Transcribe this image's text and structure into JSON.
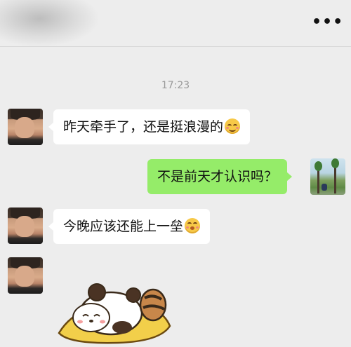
{
  "header": {
    "more_label": "•••",
    "more_icon": "more-dots-icon"
  },
  "chat": {
    "timestamp": "17:23",
    "messages": [
      {
        "side": "left",
        "text": "昨天牵手了，还是挺浪漫的",
        "emoji": "smile-emoji"
      },
      {
        "side": "right",
        "text": "不是前天才认识吗？"
      },
      {
        "side": "left",
        "text": "今晚应该还能上一垒",
        "emoji": "shy-emoji"
      },
      {
        "side": "left",
        "type": "sticker",
        "sticker": "sleeping-panda-sticker"
      }
    ]
  },
  "colors": {
    "background": "#ededed",
    "bubble_left": "#ffffff",
    "bubble_right": "#95ec69",
    "timestamp": "#9a9a9a"
  }
}
